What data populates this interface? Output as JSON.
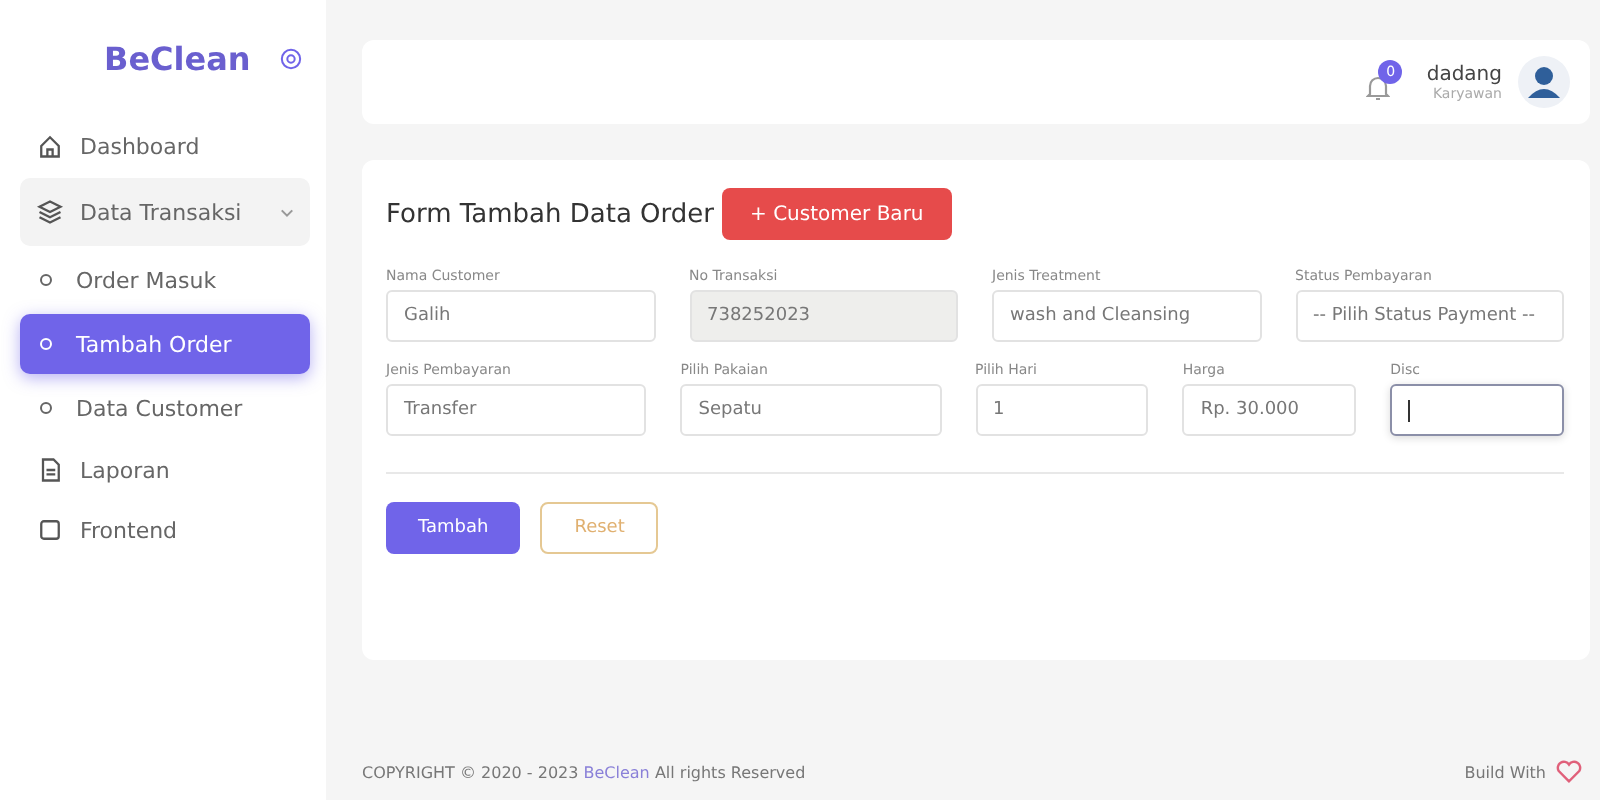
{
  "sidebar": {
    "brand": "BeClean",
    "items": [
      {
        "label": "Dashboard",
        "selected": false
      },
      {
        "label": "Data Transaksi",
        "selected": false,
        "expanded": true,
        "children": [
          {
            "label": "Order Masuk",
            "selected": false
          },
          {
            "label": "Tambah Order",
            "selected": true
          },
          {
            "label": "Data Customer",
            "selected": false
          }
        ]
      },
      {
        "label": "Laporan",
        "selected": false
      },
      {
        "label": "Frontend",
        "selected": false
      }
    ]
  },
  "header": {
    "notification_count": "0",
    "user_name": "dadang",
    "user_role": "Karyawan"
  },
  "form": {
    "title": "Form Tambah Data Order",
    "add_customer_button": "+ Customer Baru",
    "order_fields": [
      {
        "label": "Nama Customer",
        "value": "Galih",
        "kind": "input",
        "focused": false
      },
      {
        "label": "No Transaksi",
        "value": "738252023",
        "kind": "readonly",
        "focused": false
      },
      {
        "label": "Jenis Treatment",
        "value": "wash and Cleansing",
        "kind": "input",
        "focused": false
      },
      {
        "label": "Status Pembayaran",
        "value": "-- Pilih Status Payment --",
        "kind": "select",
        "focused": false
      }
    ],
    "payment_fields": [
      {
        "label": "Jenis Pembayaran",
        "value": "Transfer",
        "kind": "input",
        "focused": false
      },
      {
        "label": "Pilih Pakaian",
        "value": "Sepatu",
        "kind": "input",
        "focused": false
      },
      {
        "label": "Pilih Hari",
        "value": "1",
        "kind": "input",
        "focused": false
      },
      {
        "label": "Harga",
        "value": "Rp. 30.000",
        "kind": "input",
        "focused": false
      },
      {
        "label": "Disc",
        "kind": "input",
        "focused": true
      }
    ],
    "buttons": [
      {
        "label": "Tambah",
        "kind": "primary"
      },
      {
        "label": "Reset",
        "kind": "outline"
      }
    ]
  },
  "footer": {
    "copyright": "COPYRIGHT © 2020 - 2023",
    "brand_link": "BeClean",
    "rights": "All rights Reserved",
    "build_with": "Build With"
  }
}
